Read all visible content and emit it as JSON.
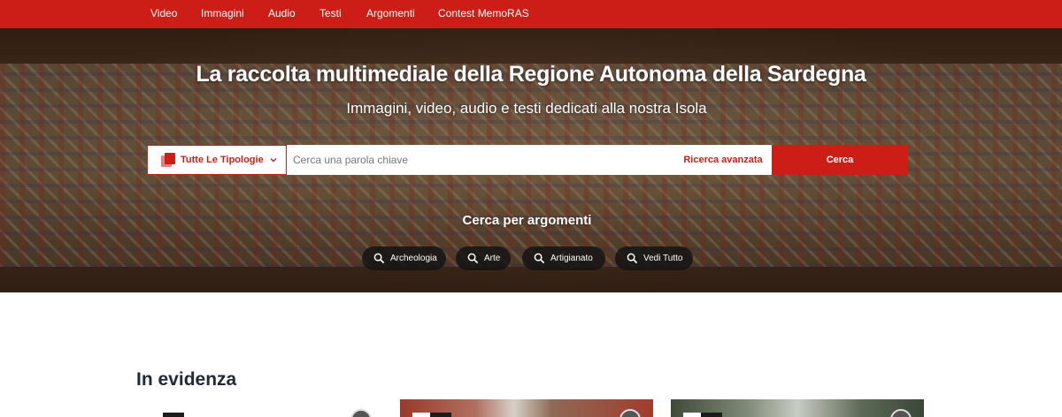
{
  "nav": {
    "items": [
      "Video",
      "Immagini",
      "Audio",
      "Testi",
      "Argomenti",
      "Contest MemoRAS"
    ]
  },
  "hero": {
    "title": "La raccolta multimediale della Regione Autonoma della Sardegna",
    "subtitle": "Immagini, video, audio e testi dedicati alla nostra Isola"
  },
  "search": {
    "type_label": "Tutte Le Tipologie",
    "placeholder": "Cerca una parola chiave",
    "advanced_label": "Ricerca avanzata",
    "submit_label": "Cerca"
  },
  "topics": {
    "heading": "Cerca per argomenti",
    "items": [
      "Archeologia",
      "Arte",
      "Artigianato",
      "Vedi Tutto"
    ]
  },
  "featured": {
    "title": "In evidenza"
  },
  "colors": {
    "brand_red": "#cc1d16",
    "chip_bg": "#141414",
    "heading_dark": "#1e2a3a"
  }
}
